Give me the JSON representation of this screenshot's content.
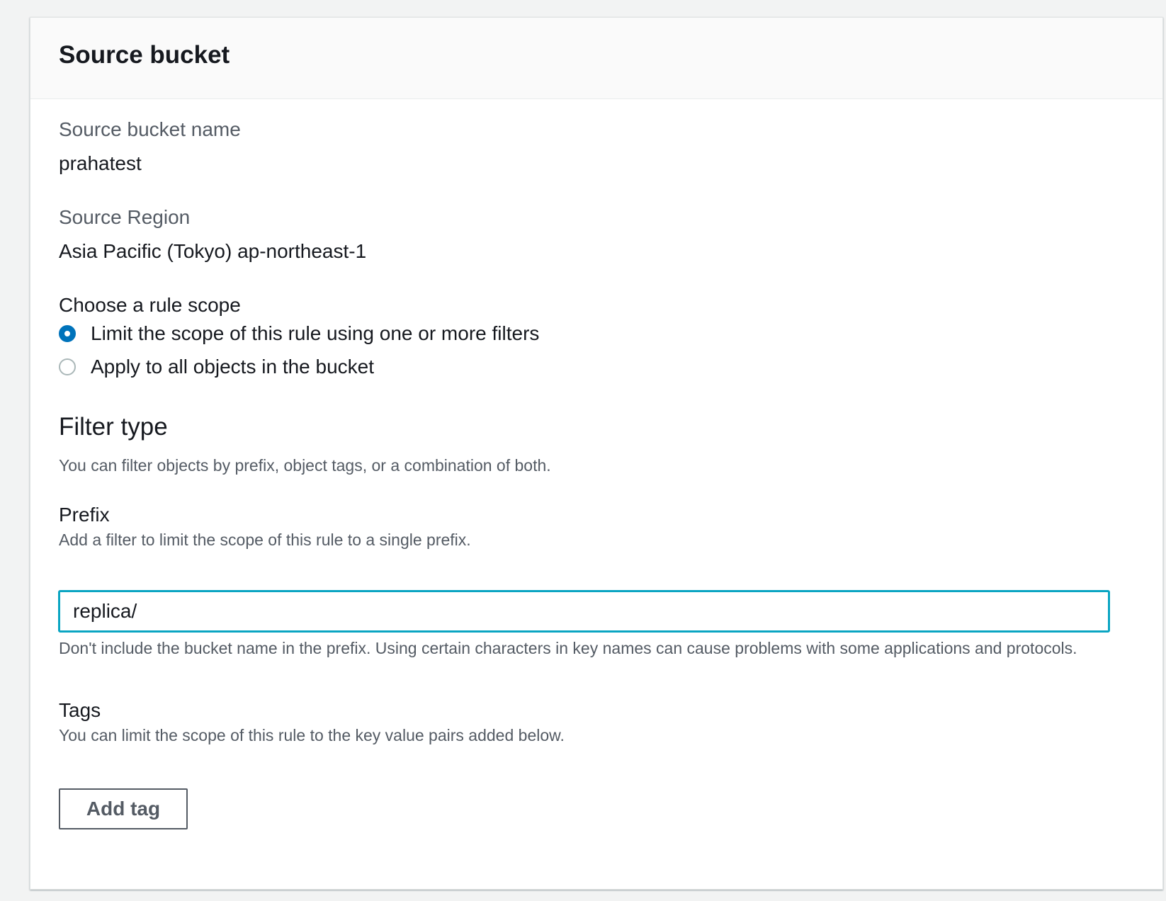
{
  "header": {
    "title": "Source bucket"
  },
  "source": {
    "bucket_name_label": "Source bucket name",
    "bucket_name_value": "prahatest",
    "region_label": "Source Region",
    "region_value": "Asia Pacific (Tokyo) ap-northeast-1"
  },
  "scope": {
    "label": "Choose a rule scope",
    "options": [
      {
        "label": "Limit the scope of this rule using one or more filters",
        "selected": true
      },
      {
        "label": "Apply to all objects in the bucket",
        "selected": false
      }
    ]
  },
  "filter": {
    "title": "Filter type",
    "description": "You can filter objects by prefix, object tags, or a combination of both."
  },
  "prefix": {
    "label": "Prefix",
    "description": "Add a filter to limit the scope of this rule to a single prefix.",
    "value": "replica/",
    "hint": "Don't include the bucket name in the prefix. Using certain characters in key names can cause problems with some applications and protocols."
  },
  "tags": {
    "label": "Tags",
    "description": "You can limit the scope of this rule to the key value pairs added below.",
    "add_button_label": "Add tag"
  },
  "colors": {
    "accent": "#0073bb",
    "focus": "#0aa5c2",
    "text": "#16191f",
    "secondary_text": "#545b64"
  }
}
